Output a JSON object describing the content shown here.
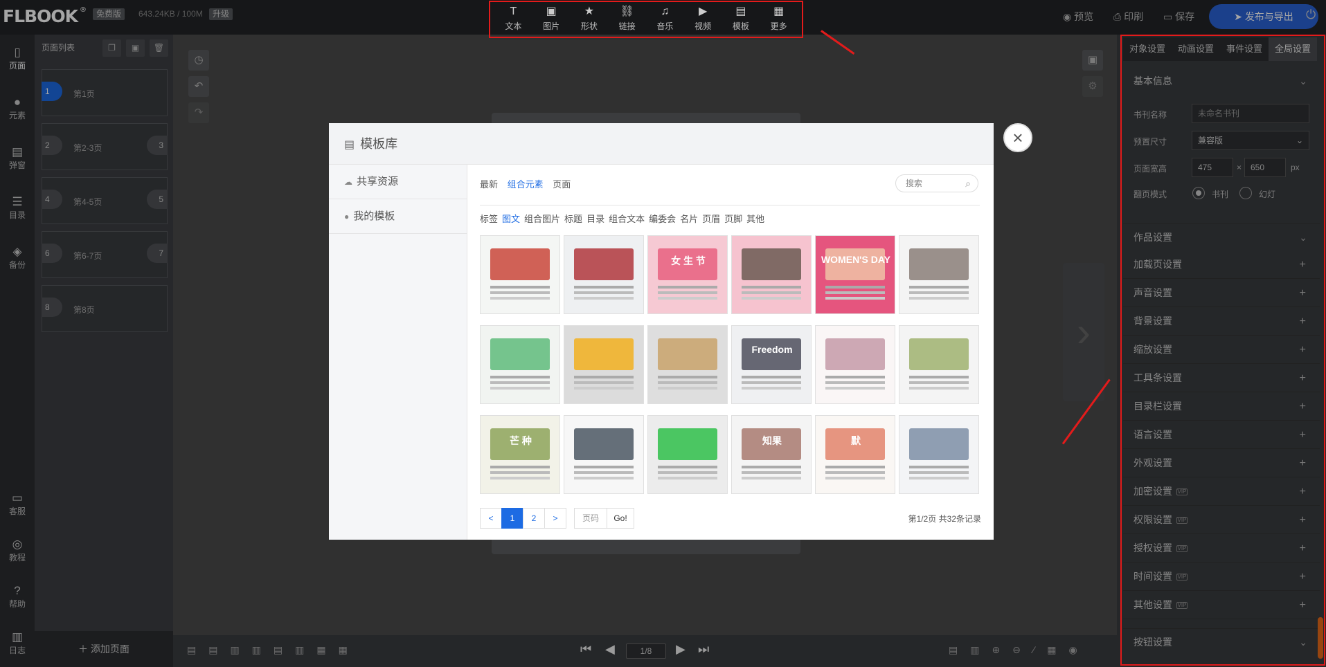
{
  "app": {
    "logo": "FLBOOK",
    "logo_mark": "®",
    "edition": "免费版",
    "storage": "643.24KB / 100M",
    "upgrade": "升级"
  },
  "toolbar": {
    "items": [
      {
        "label": "文本",
        "icon": "T"
      },
      {
        "label": "图片",
        "icon": "▣"
      },
      {
        "label": "形状",
        "icon": "★"
      },
      {
        "label": "链接",
        "icon": "⛓"
      },
      {
        "label": "音乐",
        "icon": "♫"
      },
      {
        "label": "视频",
        "icon": "▶"
      },
      {
        "label": "模板",
        "icon": "▤"
      },
      {
        "label": "更多",
        "icon": "▦"
      }
    ]
  },
  "header": {
    "preview": "预览",
    "print": "印刷",
    "save": "保存",
    "publish": "发布与导出"
  },
  "leftnav": {
    "items": [
      "页面",
      "元素",
      "弹窗",
      "目录",
      "备份"
    ],
    "bottom": [
      "客服",
      "教程",
      "帮助",
      "日志"
    ]
  },
  "pages": {
    "title": "页面列表",
    "items": [
      {
        "label": "第1页",
        "left": "1",
        "right": ""
      },
      {
        "label": "第2-3页",
        "left": "2",
        "right": "3"
      },
      {
        "label": "第4-5页",
        "left": "4",
        "right": "5"
      },
      {
        "label": "第6-7页",
        "left": "6",
        "right": "7"
      },
      {
        "label": "第8页",
        "left": "8",
        "right": ""
      }
    ],
    "add": "添加页面"
  },
  "bottom": {
    "page": "1/8"
  },
  "rightpanel": {
    "tabs": [
      "对象设置",
      "动画设置",
      "事件设置",
      "全局设置"
    ],
    "basic": {
      "title": "基本信息",
      "name_label": "书刊名称",
      "name_placeholder": "未命名书刊",
      "size_label": "预置尺寸",
      "size_value": "兼容版",
      "wh_label": "页面宽高",
      "width": "475",
      "times": "×",
      "height": "650",
      "unit": "px",
      "mode_label": "翻页模式",
      "mode_book": "书刊",
      "mode_slide": "幻灯"
    },
    "work": "作品设置",
    "rows": [
      {
        "label": "加载页设置",
        "vip": ""
      },
      {
        "label": "声音设置",
        "vip": ""
      },
      {
        "label": "背景设置",
        "vip": ""
      },
      {
        "label": "缩放设置",
        "vip": ""
      },
      {
        "label": "工具条设置",
        "vip": ""
      },
      {
        "label": "目录栏设置",
        "vip": ""
      },
      {
        "label": "语言设置",
        "vip": ""
      },
      {
        "label": "外观设置",
        "vip": ""
      },
      {
        "label": "加密设置",
        "vip": "VIP"
      },
      {
        "label": "权限设置",
        "vip": "VIP"
      },
      {
        "label": "授权设置",
        "vip": "VIP"
      },
      {
        "label": "时间设置",
        "vip": "VIP"
      },
      {
        "label": "其他设置",
        "vip": "VIP"
      }
    ],
    "button": "按钮设置"
  },
  "modal": {
    "title": "模板库",
    "side": [
      "共享资源",
      "我的模板"
    ],
    "tabs": [
      "最新",
      "组合元素",
      "页面"
    ],
    "search": "搜索",
    "cats": [
      "标签",
      "图文",
      "组合图片",
      "标题",
      "目录",
      "组合文本",
      "编委会",
      "名片",
      "页眉",
      "页脚",
      "其他"
    ],
    "thumbs": [
      {
        "bg": "#f4f6f4",
        "acc": "#c9463a",
        "text": ""
      },
      {
        "bg": "#eef0f2",
        "acc": "#b0373d",
        "text": ""
      },
      {
        "bg": "#f6c9d3",
        "acc": "#e8607f",
        "text": "女 生 节"
      },
      {
        "bg": "#f6c3cf",
        "acc": "#6b5b52",
        "text": ""
      },
      {
        "bg": "#e5557e",
        "acc": "#f0c3a6",
        "text": "WOMEN'S DAY"
      },
      {
        "bg": "#f4f4f4",
        "acc": "#8a7e78",
        "text": ""
      },
      {
        "bg": "#f1f4f1",
        "acc": "#5fbb7b",
        "text": ""
      },
      {
        "bg": "#dcdcdc",
        "acc": "#f2b020",
        "text": ""
      },
      {
        "bg": "#dedede",
        "acc": "#c9a36b",
        "text": ""
      },
      {
        "bg": "#eff0f2",
        "acc": "#4e4f5d",
        "text": "Freedom"
      },
      {
        "bg": "#faf6f6",
        "acc": "#c49aa8",
        "text": ""
      },
      {
        "bg": "#f4f4f4",
        "acc": "#9fb26e",
        "text": ""
      },
      {
        "bg": "#f2f2e8",
        "acc": "#8ea45a",
        "text": "芒 种"
      },
      {
        "bg": "#f7f7f7",
        "acc": "#4b5763",
        "text": ""
      },
      {
        "bg": "#ececec",
        "acc": "#2fbf4a",
        "text": ""
      },
      {
        "bg": "#f4f4f4",
        "acc": "#a8796f",
        "text": "知果"
      },
      {
        "bg": "#faf7f4",
        "acc": "#e2846b",
        "text": "默"
      },
      {
        "bg": "#f3f4f6",
        "acc": "#7c8ea6",
        "text": ""
      }
    ],
    "pager": {
      "prev": "<",
      "p1": "1",
      "p2": "2",
      "next": ">",
      "input": "页码",
      "go": "Go!",
      "total": "第1/2页  共32条记录"
    }
  }
}
